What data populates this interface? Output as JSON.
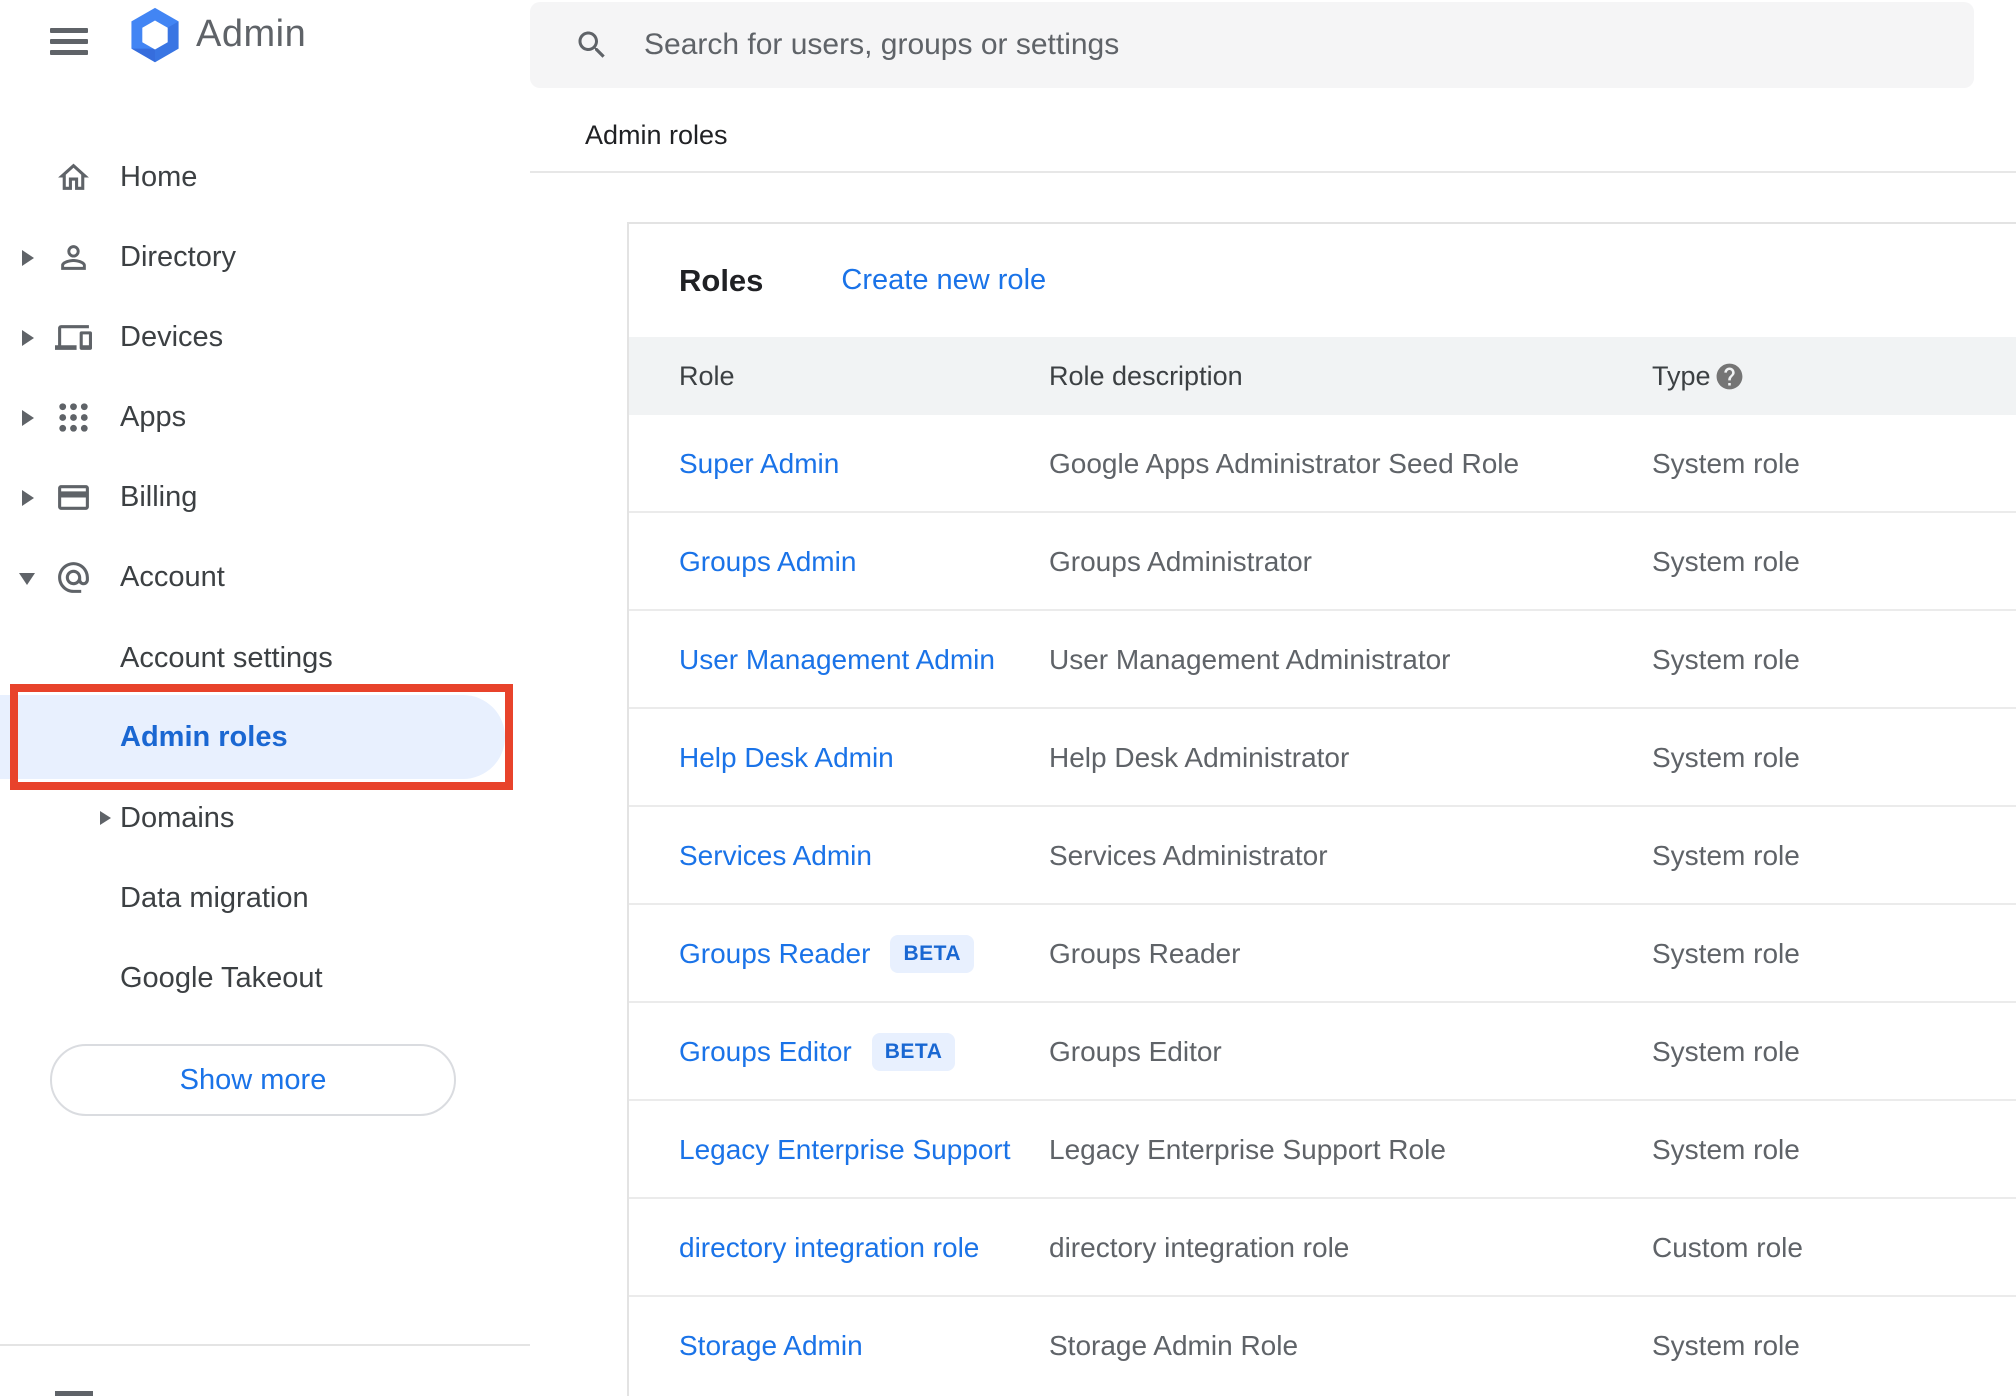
{
  "app": {
    "title": "Admin"
  },
  "search": {
    "placeholder": "Search for users, groups or settings"
  },
  "breadcrumb": "Admin roles",
  "sidebar": {
    "items": [
      {
        "label": "Home"
      },
      {
        "label": "Directory"
      },
      {
        "label": "Devices"
      },
      {
        "label": "Apps"
      },
      {
        "label": "Billing"
      },
      {
        "label": "Account"
      }
    ],
    "account_children": [
      {
        "label": "Account settings"
      },
      {
        "label": "Admin roles",
        "selected": true
      },
      {
        "label": "Domains"
      },
      {
        "label": "Data migration"
      },
      {
        "label": "Google Takeout"
      }
    ],
    "show_more_label": "Show more"
  },
  "roles_panel": {
    "title": "Roles",
    "create_link": "Create new role",
    "columns": {
      "role": "Role",
      "description": "Role description",
      "type": "Type"
    },
    "rows": [
      {
        "role": "Super Admin",
        "description": "Google Apps Administrator Seed Role",
        "type": "System role"
      },
      {
        "role": "Groups Admin",
        "description": "Groups Administrator",
        "type": "System role"
      },
      {
        "role": "User Management Admin",
        "description": "User Management Administrator",
        "type": "System role"
      },
      {
        "role": "Help Desk Admin",
        "description": "Help Desk Administrator",
        "type": "System role"
      },
      {
        "role": "Services Admin",
        "description": "Services Administrator",
        "type": "System role"
      },
      {
        "role": "Groups Reader",
        "badge": "BETA",
        "description": "Groups Reader",
        "type": "System role"
      },
      {
        "role": "Groups Editor",
        "badge": "BETA",
        "description": "Groups Editor",
        "type": "System role"
      },
      {
        "role": "Legacy Enterprise Support",
        "description": "Legacy Enterprise Support Role",
        "type": "System role"
      },
      {
        "role": "directory integration role",
        "description": "directory integration role",
        "type": "Custom role"
      },
      {
        "role": "Storage Admin",
        "description": "Storage Admin Role",
        "type": "System role"
      }
    ]
  },
  "colors": {
    "link_blue": "#1a73e8",
    "selected_blue": "#1967d2",
    "selected_pill_bg": "#e8f0fe",
    "annotation_red": "#e8432b",
    "header_bg": "#f1f3f4",
    "text_dark": "#202124",
    "text_gray": "#5f6368"
  }
}
